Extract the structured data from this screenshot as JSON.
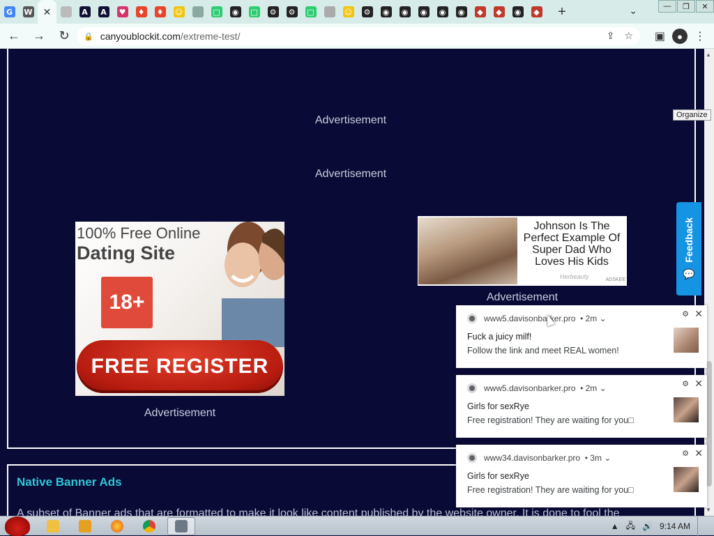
{
  "browser": {
    "tabs": [
      {
        "icon": "google-icon",
        "glyph": "G",
        "color": "#4285f4"
      },
      {
        "icon": "wikipedia-icon",
        "glyph": "W",
        "color": "#555555"
      },
      {
        "icon": "active-tab",
        "glyph": "",
        "color": "#f3fbfa",
        "active": true
      },
      {
        "icon": "grey-circle-icon",
        "glyph": "",
        "color": "#bbbbbb"
      },
      {
        "icon": "a-icon",
        "glyph": "A",
        "color": "#111133"
      },
      {
        "icon": "a-icon",
        "glyph": "A",
        "color": "#111133"
      },
      {
        "icon": "shield-pink-icon",
        "glyph": "♥",
        "color": "#d6336c"
      },
      {
        "icon": "brave-icon",
        "glyph": "♦",
        "color": "#e8442c"
      },
      {
        "icon": "brave-icon",
        "glyph": "♦",
        "color": "#e8442c"
      },
      {
        "icon": "smiley-icon",
        "glyph": "☺",
        "color": "#f1c40f"
      },
      {
        "icon": "circle-icon",
        "glyph": "",
        "color": "#8aa9a0"
      },
      {
        "icon": "green-square-icon",
        "glyph": "□",
        "color": "#2ecc71"
      },
      {
        "icon": "globe-icon",
        "glyph": "◉",
        "color": "#222222"
      },
      {
        "icon": "green-square-icon",
        "glyph": "□",
        "color": "#2ecc71"
      },
      {
        "icon": "gear-icon",
        "glyph": "⚙",
        "color": "#222222"
      },
      {
        "icon": "gear-icon",
        "glyph": "⚙",
        "color": "#222222"
      },
      {
        "icon": "green-square-icon",
        "glyph": "□",
        "color": "#2ecc71"
      },
      {
        "icon": "grey-circle-icon",
        "glyph": "",
        "color": "#aaaaaa"
      },
      {
        "icon": "smiley-icon",
        "glyph": "☺",
        "color": "#f1c40f"
      },
      {
        "icon": "gear-icon",
        "glyph": "⚙",
        "color": "#222222"
      },
      {
        "icon": "globe-icon",
        "glyph": "◉",
        "color": "#222222"
      },
      {
        "icon": "globe-icon",
        "glyph": "◉",
        "color": "#222222"
      },
      {
        "icon": "globe-icon",
        "glyph": "◉",
        "color": "#222222"
      },
      {
        "icon": "globe-icon",
        "glyph": "◉",
        "color": "#222222"
      },
      {
        "icon": "globe-icon",
        "glyph": "◉",
        "color": "#222222"
      },
      {
        "icon": "shield-red-icon",
        "glyph": "◆",
        "color": "#c0392b"
      },
      {
        "icon": "shield-red-icon",
        "glyph": "◆",
        "color": "#c0392b"
      },
      {
        "icon": "globe-icon",
        "glyph": "◉",
        "color": "#222222"
      },
      {
        "icon": "shield-red-icon",
        "glyph": "◆",
        "color": "#c0392b"
      }
    ],
    "new_tab_label": "+",
    "address": {
      "host": "canyoublockit.com",
      "path": "/extreme-test/"
    }
  },
  "page": {
    "ad_labels": [
      "Advertisement",
      "Advertisement",
      "Advertisement",
      "Advertisement"
    ],
    "dating_ad": {
      "line1": "100% Free Online",
      "line2": "Dating Site",
      "badge": "18+",
      "button": "FREE REGISTER"
    },
    "news_ad": {
      "headline": "Johnson Is The Perfect Example Of Super Dad Who Loves His Kids",
      "source": "Herbeauty",
      "network": "ADSKEE"
    },
    "section": {
      "title": "Native Banner Ads",
      "desc": "A subset of Banner ads that are formatted to make it look like content published by the website owner. It is done to fool the"
    },
    "feedback_label": "Feedback",
    "tooltip": "Organize"
  },
  "notifications": [
    {
      "origin": "www5.davisonbarker.pro",
      "age": "2m",
      "title": "Fuck a juicy milf!",
      "body": "Follow the link and meet REAL women!"
    },
    {
      "origin": "www5.davisonbarker.pro",
      "age": "2m",
      "title": "Girls for sexRye",
      "body": "Free registration! They are waiting for you□"
    },
    {
      "origin": "www34.davisonbarker.pro",
      "age": "3m",
      "title": "Girls for sexRye",
      "body": "Free registration! They are waiting for you□"
    }
  ],
  "taskbar": {
    "clock": "9:14 AM"
  }
}
